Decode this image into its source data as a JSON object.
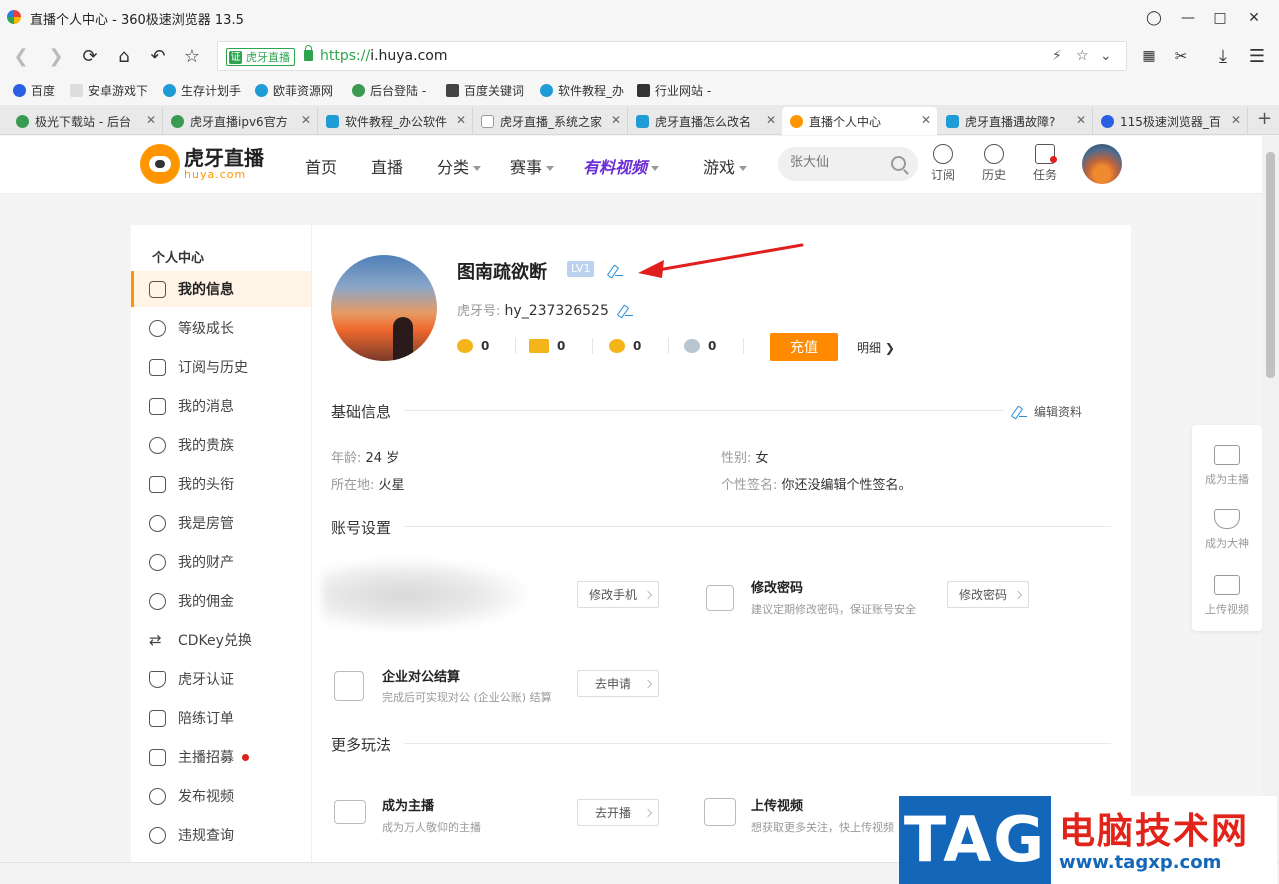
{
  "window": {
    "title": "直播个人中心 - 360极速浏览器 13.5"
  },
  "addressbar": {
    "cert_label": "虎牙直播",
    "cert_badge": "证",
    "url_scheme": "https://",
    "url_host": "i.huya.com"
  },
  "bookmarks": [
    {
      "label": "百度",
      "color": "#2b5fe3"
    },
    {
      "label": "安卓游戏下",
      "color": "#cccccc"
    },
    {
      "label": "生存计划手",
      "color": "#1f9bd6"
    },
    {
      "label": "欧菲资源网",
      "color": "#1f9bd6"
    },
    {
      "label": "后台登陆 -",
      "color": "#3a9a52"
    },
    {
      "label": "百度关键词",
      "color": "#444444"
    },
    {
      "label": "软件教程_办",
      "color": "#1f9bd6"
    },
    {
      "label": "行业网站 -",
      "color": "#333333"
    }
  ],
  "tabs": [
    {
      "label": "极光下载站 - 后台",
      "color": "#3a9a52"
    },
    {
      "label": "虎牙直播ipv6官方",
      "color": "#3a9a52"
    },
    {
      "label": "软件教程_办公软件",
      "color": "#1f9bd6"
    },
    {
      "label": "虎牙直播_系统之家",
      "color": "#cccccc"
    },
    {
      "label": "虎牙直播怎么改名",
      "color": "#1f9bd6"
    },
    {
      "label": "直播个人中心",
      "color": "#ff9600"
    },
    {
      "label": "虎牙直播遇故障?",
      "color": "#1f9bd6"
    },
    {
      "label": "115极速浏览器_百",
      "color": "#2b5fe3"
    }
  ],
  "site": {
    "logo_cn": "虎牙直播",
    "logo_en": "huya.com",
    "nav": {
      "home": "首页",
      "live": "直播",
      "category": "分类",
      "events": "赛事",
      "video": "有料视频",
      "games": "游戏"
    },
    "search_placeholder": "张大仙",
    "icons": {
      "subscribe": "订阅",
      "history": "历史",
      "tasks": "任务"
    }
  },
  "sidebar": {
    "heading": "个人中心",
    "items": [
      {
        "label": "我的信息"
      },
      {
        "label": "等级成长"
      },
      {
        "label": "订阅与历史"
      },
      {
        "label": "我的消息"
      },
      {
        "label": "我的贵族"
      },
      {
        "label": "我的头衔"
      },
      {
        "label": "我是房管"
      },
      {
        "label": "我的财产"
      },
      {
        "label": "我的佣金"
      },
      {
        "label": "CDKey兑换"
      },
      {
        "label": "虎牙认证"
      },
      {
        "label": "陪练订单"
      },
      {
        "label": "主播招募"
      },
      {
        "label": "发布视频"
      },
      {
        "label": "违规查询"
      }
    ]
  },
  "profile": {
    "name": "图南疏欲断",
    "level": "LV1",
    "id_label": "虎牙号:",
    "id_value": "hy_237326525",
    "stats": [
      "0",
      "0",
      "0",
      "0"
    ],
    "recharge": "充值",
    "detail": "明细"
  },
  "basic": {
    "title": "基础信息",
    "edit": "编辑资料",
    "age_label": "年龄:",
    "age_value": "24 岁",
    "gender_label": "性别:",
    "gender_value": "女",
    "location_label": "所在地:",
    "location_value": "火星",
    "signature_label": "个性签名:",
    "signature_value": "你还没编辑个性签名。"
  },
  "account": {
    "title": "账号设置",
    "change_phone": "修改手机",
    "password_title": "修改密码",
    "password_desc": "建议定期修改密码，保证账号安全",
    "change_password": "修改密码",
    "enterprise_title": "企业对公结算",
    "enterprise_desc": "完成后可实现对公 (企业公账) 结算",
    "apply": "去申请"
  },
  "more": {
    "title": "更多玩法",
    "streamer_title": "成为主播",
    "streamer_desc": "成为万人敬仰的主播",
    "go_live": "去开播",
    "upload_title": "上传视频",
    "upload_desc": "想获取更多关注，快上传视频"
  },
  "float_panel": {
    "become_streamer": "成为主播",
    "become_master": "成为大神",
    "upload_video": "上传视频"
  },
  "watermark": {
    "tag": "TAG",
    "cn": "电脑技术网",
    "url": "www.tagxp.com"
  },
  "colors": {
    "accent": "#ff8a00",
    "brand": "#ff9600",
    "secure": "#2ea44f",
    "annotation_arrow": "#e0201c"
  }
}
